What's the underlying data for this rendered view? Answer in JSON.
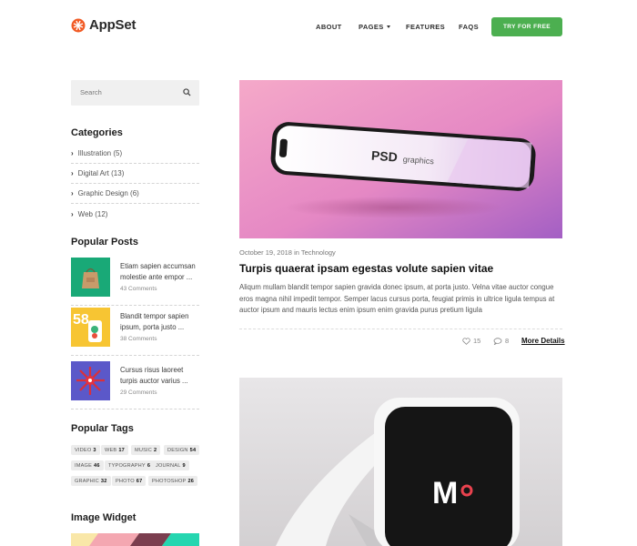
{
  "header": {
    "brand": "AppSet",
    "nav": [
      {
        "label": "ABOUT"
      },
      {
        "label": "PAGES"
      },
      {
        "label": "FEATURES"
      },
      {
        "label": "FAQS"
      }
    ],
    "cta_label": "TRY FOR FREE",
    "cta_color": "#4caf50"
  },
  "sidebar": {
    "search_placeholder": "Search",
    "categories_title": "Categories",
    "categories": [
      {
        "label": "Illustration (5)"
      },
      {
        "label": "Digital Art (13)"
      },
      {
        "label": "Graphic Design (6)"
      },
      {
        "label": "Web (12)"
      }
    ],
    "popular_posts_title": "Popular Posts",
    "popular_posts": [
      {
        "title": "Etiam sapien accumsan molestie ante empor ...",
        "comments": "43 Comments"
      },
      {
        "title": "Blandit tempor sapien ipsum, porta justo ...",
        "comments": "38 Comments"
      },
      {
        "title": "Cursus risus laoreet turpis auctor varius ...",
        "comments": "29 Comments"
      }
    ],
    "popular_tags_title": "Popular Tags",
    "tags": [
      {
        "name": "VIDEO",
        "count": "3"
      },
      {
        "name": "WEB",
        "count": "17"
      },
      {
        "name": "MUSIC",
        "count": "2"
      },
      {
        "name": "DESIGN",
        "count": "54"
      },
      {
        "name": "IMAGE",
        "count": "46"
      },
      {
        "name": "TYPOGRAPHY",
        "count": "6"
      },
      {
        "name": "JOURNAL",
        "count": "9"
      },
      {
        "name": "GRAPHIC",
        "count": "32"
      },
      {
        "name": "PHOTO",
        "count": "67"
      },
      {
        "name": "PHOTOSHOP",
        "count": "26"
      }
    ],
    "image_widget_title": "Image Widget"
  },
  "main": {
    "post1": {
      "date": "October 19, 2018",
      "in": "in",
      "category": "Technology",
      "title": "Turpis quaerat ipsam egestas volute sapien vitae",
      "excerpt": "Aliqum mullam blandit tempor sapien gravida donec ipsum, at porta justo. Velna vitae auctor congue eros magna nihil impedit tempor. Semper lacus cursus porta, feugiat primis in ultrice ligula tempus at auctor ipsum and mauris lectus enim ipsum enim gravida purus pretium ligula",
      "likes": "15",
      "comments": "8",
      "more_label": "More Details"
    }
  }
}
